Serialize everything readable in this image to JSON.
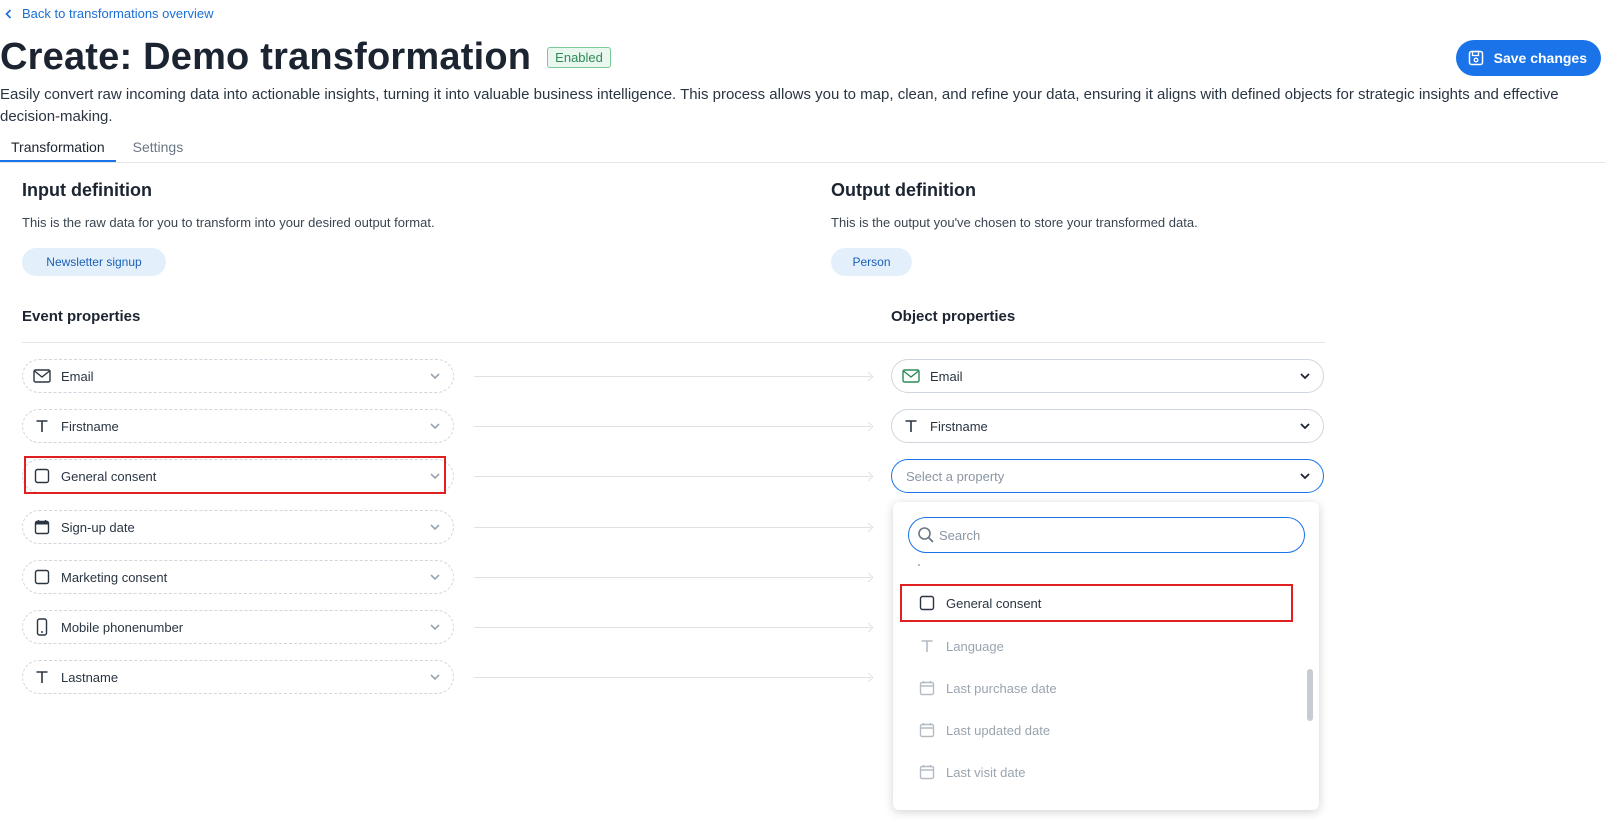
{
  "back_link": "Back to transformations overview",
  "page_title": "Create: Demo transformation",
  "status_badge": "Enabled",
  "save_button": "Save changes",
  "description": "Easily convert raw incoming data into actionable insights, turning it into valuable business intelligence. This process allows you to map, clean, and refine your data, ensuring it aligns with defined objects for strategic insights and effective decision-making.",
  "tabs": [
    {
      "label": "Transformation",
      "active": true
    },
    {
      "label": "Settings",
      "active": false
    }
  ],
  "input": {
    "title": "Input definition",
    "desc": "This is the raw data for you to transform into your desired output format.",
    "chip": "Newsletter signup",
    "column_header": "Event properties"
  },
  "output": {
    "title": "Output definition",
    "desc": "This is the output you've chosen to store your transformed data.",
    "chip": "Person",
    "column_header": "Object properties"
  },
  "mappings": [
    {
      "input": {
        "label": "Email",
        "icon": "mail-icon"
      },
      "output": {
        "label": "Email",
        "icon": "mail-icon"
      }
    },
    {
      "input": {
        "label": "Firstname",
        "icon": "text-icon"
      },
      "output": {
        "label": "Firstname",
        "icon": "text-icon"
      }
    },
    {
      "input": {
        "label": "General consent",
        "icon": "checkbox-icon"
      },
      "output": {
        "placeholder": "Select a property"
      }
    },
    {
      "input": {
        "label": "Sign-up date",
        "icon": "calendar-icon"
      }
    },
    {
      "input": {
        "label": "Marketing consent",
        "icon": "checkbox-icon"
      }
    },
    {
      "input": {
        "label": "Mobile phonenumber",
        "icon": "phone-icon"
      }
    },
    {
      "input": {
        "label": "Lastname",
        "icon": "text-icon"
      }
    }
  ],
  "dropdown": {
    "search_placeholder": "Search",
    "items": [
      {
        "label": "General consent",
        "icon": "checkbox-icon",
        "enabled": true
      },
      {
        "label": "Language",
        "icon": "text-icon",
        "enabled": false
      },
      {
        "label": "Last purchase date",
        "icon": "calendar-icon",
        "enabled": false
      },
      {
        "label": "Last updated date",
        "icon": "calendar-icon",
        "enabled": false
      },
      {
        "label": "Last visit date",
        "icon": "calendar-icon",
        "enabled": false
      }
    ]
  },
  "colors": {
    "accent": "#1a73e8",
    "badge_green": "#2d8a55",
    "highlight_red": "#e02020"
  }
}
